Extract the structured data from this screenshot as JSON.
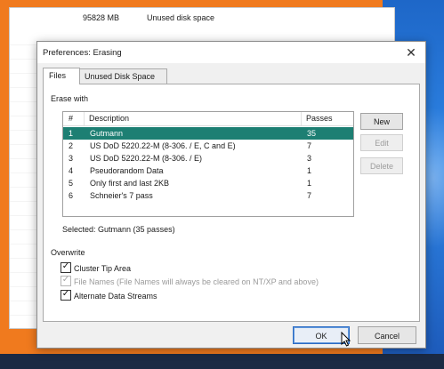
{
  "background": {
    "row_size": "95828 MB",
    "row_description": "Unused disk space"
  },
  "dialog": {
    "title": "Preferences: Erasing",
    "close_glyph": "✕",
    "tabs": [
      {
        "label": "Files",
        "active": true
      },
      {
        "label": "Unused Disk Space",
        "active": false
      }
    ],
    "erase_group_label": "Erase with",
    "columns": [
      "#",
      "Description",
      "Passes"
    ],
    "methods": [
      {
        "num": "1",
        "description": "Gutmann",
        "passes": "35",
        "selected": true
      },
      {
        "num": "2",
        "description": "US DoD 5220.22-M (8-306. / E, C and E)",
        "passes": "7",
        "selected": false
      },
      {
        "num": "3",
        "description": "US DoD 5220.22-M (8-306. / E)",
        "passes": "3",
        "selected": false
      },
      {
        "num": "4",
        "description": "Pseudorandom Data",
        "passes": "1",
        "selected": false
      },
      {
        "num": "5",
        "description": "Only first and last 2KB",
        "passes": "1",
        "selected": false
      },
      {
        "num": "6",
        "description": "Schneier's 7 pass",
        "passes": "7",
        "selected": false
      }
    ],
    "buttons": {
      "new": "New",
      "edit": "Edit",
      "delete": "Delete",
      "ok": "OK",
      "cancel": "Cancel"
    },
    "selected_text": "Selected: Gutmann (35 passes)",
    "overwrite_group_label": "Overwrite",
    "options": [
      {
        "label": "Cluster Tip Area",
        "checked": true,
        "enabled": true
      },
      {
        "label": "File Names (File Names will always be cleared on NT/XP and above)",
        "checked": true,
        "enabled": false
      },
      {
        "label": "Alternate Data Streams",
        "checked": true,
        "enabled": true
      }
    ]
  },
  "colors": {
    "selection": "#1d7f73",
    "frame": "#f07a1e",
    "desktop": "#2f86e6"
  },
  "icons": [
    "close-icon",
    "checkmark-icon",
    "mouse-pointer-icon"
  ]
}
